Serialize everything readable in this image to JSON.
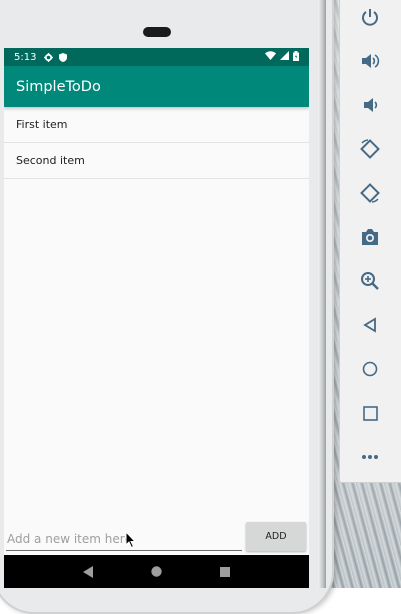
{
  "status_bar": {
    "time": "5:13"
  },
  "app": {
    "title": "SimpleToDo"
  },
  "items": [
    "First item",
    "Second item"
  ],
  "input": {
    "placeholder": "Add a new item here",
    "value": ""
  },
  "add_button": {
    "label": "ADD"
  },
  "colors": {
    "status_bar": "#00695c",
    "app_bar": "#00897b",
    "nav_bar": "#000000"
  },
  "emulator_toolbar": {
    "icons": [
      "power-icon",
      "volume-up-icon",
      "volume-down-icon",
      "rotate-left-icon",
      "rotate-right-icon",
      "camera-icon",
      "zoom-icon",
      "back-icon",
      "home-icon",
      "overview-icon",
      "more-icon"
    ]
  }
}
